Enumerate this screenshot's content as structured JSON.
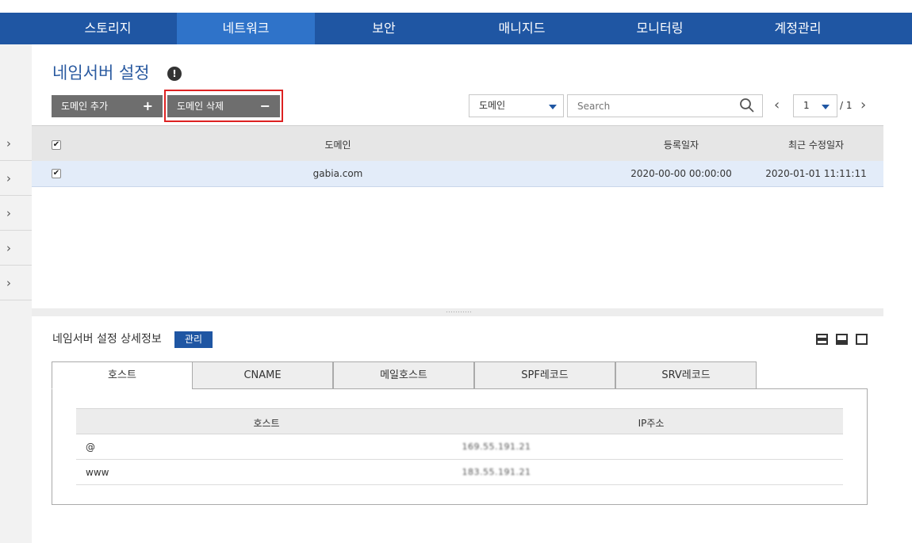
{
  "nav": {
    "items": [
      "스토리지",
      "네트워크",
      "보안",
      "매니지드",
      "모니터링",
      "계정관리"
    ],
    "active": "네트워크"
  },
  "page": {
    "title": "네임서버 설정",
    "info_icon": "!"
  },
  "toolbar": {
    "add_label": "도메인 추가",
    "add_sign": "+",
    "delete_label": "도메인 삭제",
    "delete_sign": "−",
    "filter_select": "도메인",
    "search_placeholder": "Search",
    "page_current": "1",
    "page_total": "/ 1"
  },
  "domain_table": {
    "columns": [
      "도메인",
      "등록일자",
      "최근 수정일자"
    ],
    "rows": [
      {
        "domain": "gabia.com",
        "registered": "2020-00-00 00:00:00",
        "modified": "2020-01-01 11:11:11",
        "checked": true
      }
    ]
  },
  "detail": {
    "title": "네임서버 설정 상세정보",
    "manage_label": "관리",
    "tabs": [
      "호스트",
      "CNAME",
      "메일호스트",
      "SPF레코드",
      "SRV레코드"
    ],
    "active_tab": "호스트",
    "host_table": {
      "columns": [
        "호스트",
        "IP주소"
      ],
      "rows": [
        {
          "host": "@",
          "ip": "169.55.191.21"
        },
        {
          "host": "www",
          "ip": "183.55.191.21"
        }
      ]
    }
  },
  "colors": {
    "nav_bg": "#1f56a3",
    "nav_active": "#2f73c9",
    "title": "#2a5aa0",
    "row_selected": "#e3ecf9",
    "highlight": "#dd2222"
  },
  "icons": [
    "info-icon",
    "plus-icon",
    "minus-icon",
    "chevron-down-icon",
    "search-icon",
    "chevron-left-icon",
    "chevron-right-icon",
    "checkbox-icon",
    "view-split-icon"
  ]
}
